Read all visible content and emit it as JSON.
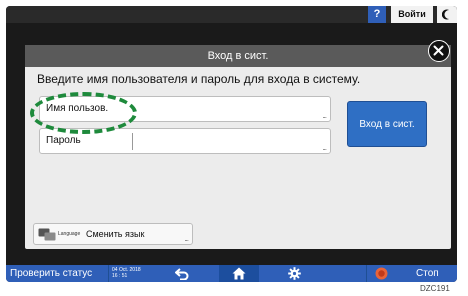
{
  "topbar": {
    "help_label": "?",
    "login_label": "Войти",
    "moon_icon": "moon-icon"
  },
  "dialog": {
    "title": "Вход в сист.",
    "instruction": "Введите имя пользователя и пароль для входа в систему.",
    "username_label": "Имя пользов.",
    "username_value": "",
    "password_label": "Пароль",
    "password_value": "",
    "field_ellipsis": "...",
    "submit_label": "Вход в сист.",
    "close_icon": "close-icon",
    "highlight_color": "#1e8a3c"
  },
  "language": {
    "small_label": "Language",
    "label": "Сменить язык",
    "icon": "language-icon"
  },
  "bottombar": {
    "status_label": "Проверить статус",
    "date": "04 Oct. 2018",
    "time": "16 : 51",
    "back_icon": "back-icon",
    "home_icon": "home-icon",
    "settings_icon": "gear-icon",
    "stop_icon": "stop-icon",
    "stop_label": "Стоп",
    "accent": "#2f5fb8"
  },
  "figure_code": "DZC191"
}
